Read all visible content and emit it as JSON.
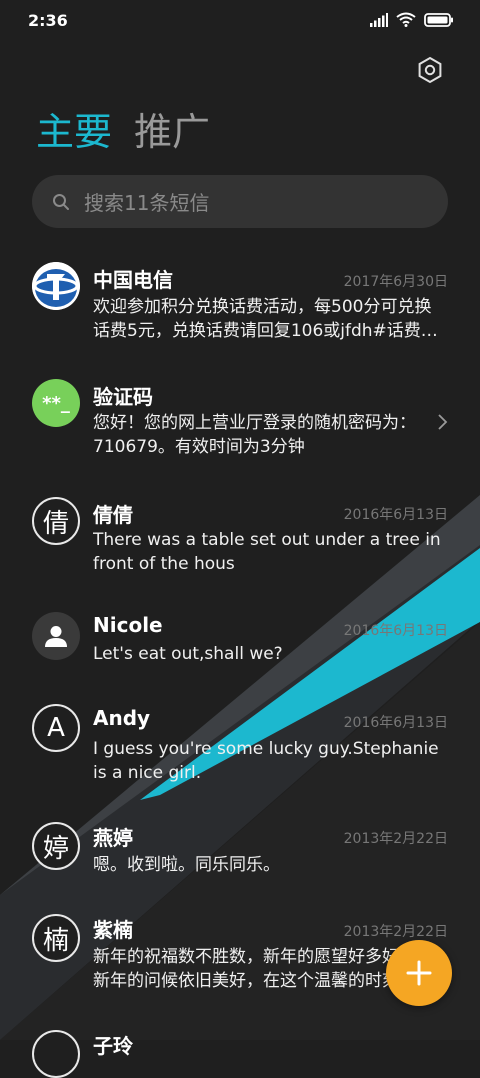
{
  "status_bar": {
    "time": "2:36",
    "icons": [
      "signal-icon",
      "wifi-icon",
      "battery-icon"
    ]
  },
  "header": {
    "settings_icon": "settings-hex-icon",
    "tabs": [
      {
        "label": "主要",
        "active": true
      },
      {
        "label": "推广",
        "active": false
      }
    ]
  },
  "search": {
    "placeholder": "搜索11条短信",
    "icon": "search-icon"
  },
  "accent_color": "#1cb8cf",
  "fab": {
    "icon": "plus-icon",
    "color": "#f5a623"
  },
  "conversations": [
    {
      "name": "中国电信",
      "date": "2017年6月30日",
      "snippet": "欢迎参加积分兑换话费活动，每500分可兑换话费5元，兑换话费请回复106或jfdh#话费…",
      "avatar": {
        "type": "logo",
        "icon": "china-telecom-logo-icon"
      }
    },
    {
      "name": "验证码",
      "date": "",
      "snippet": "您好！您的网上营业厅登录的随机密码为：710679。有效时间为3分钟",
      "avatar": {
        "type": "text",
        "text": "**_",
        "color": "#78d05a"
      },
      "chevron": "chevron-right-icon"
    },
    {
      "name": "倩倩",
      "date": "2016年6月13日",
      "snippet": "There was a table set out under a tree in front of the hous",
      "avatar": {
        "type": "letter",
        "text": "倩"
      }
    },
    {
      "name": "Nicole",
      "date": "2016年6月13日",
      "snippet": "Let's eat out,shall we?",
      "avatar": {
        "type": "person",
        "icon": "person-icon"
      }
    },
    {
      "name": "Andy",
      "date": "2016年6月13日",
      "snippet": "I guess you're some lucky guy.Stephanie is a nice girl.",
      "avatar": {
        "type": "letter",
        "text": "A"
      }
    },
    {
      "name": "燕婷",
      "date": "2013年2月22日",
      "snippet": "嗯。收到啦。同乐同乐。",
      "avatar": {
        "type": "letter",
        "text": "婷"
      }
    },
    {
      "name": "紫楠",
      "date": "2013年2月22日",
      "snippet": "新年的祝福数不胜数，新年的愿望好多好多，新年的问候依旧美好，在这个温馨的时刻…",
      "avatar": {
        "type": "letter",
        "text": "楠"
      }
    },
    {
      "name": "子玲",
      "date": "",
      "snippet": "",
      "avatar": {
        "type": "letter",
        "text": ""
      }
    }
  ]
}
